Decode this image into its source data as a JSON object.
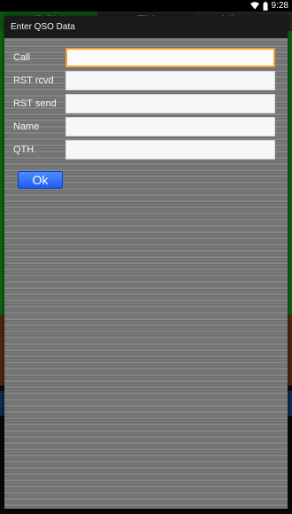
{
  "status_bar": {
    "time": "9:28",
    "icons": [
      "wifi-icon",
      "battery-icon"
    ]
  },
  "background_app": {
    "tabs": [
      "RCV",
      "TX",
      "History"
    ]
  },
  "dialog": {
    "title": "Enter QSO Data",
    "fields": [
      {
        "label": "Call",
        "value": "",
        "focused": true
      },
      {
        "label": "RST rcvd",
        "value": ""
      },
      {
        "label": "RST send",
        "value": ""
      },
      {
        "label": "Name",
        "value": ""
      },
      {
        "label": "QTH",
        "value": ""
      }
    ],
    "ok_label": "Ok"
  },
  "colors": {
    "accent_focus": "#f0a030",
    "ok_button": "#2f6bff"
  }
}
